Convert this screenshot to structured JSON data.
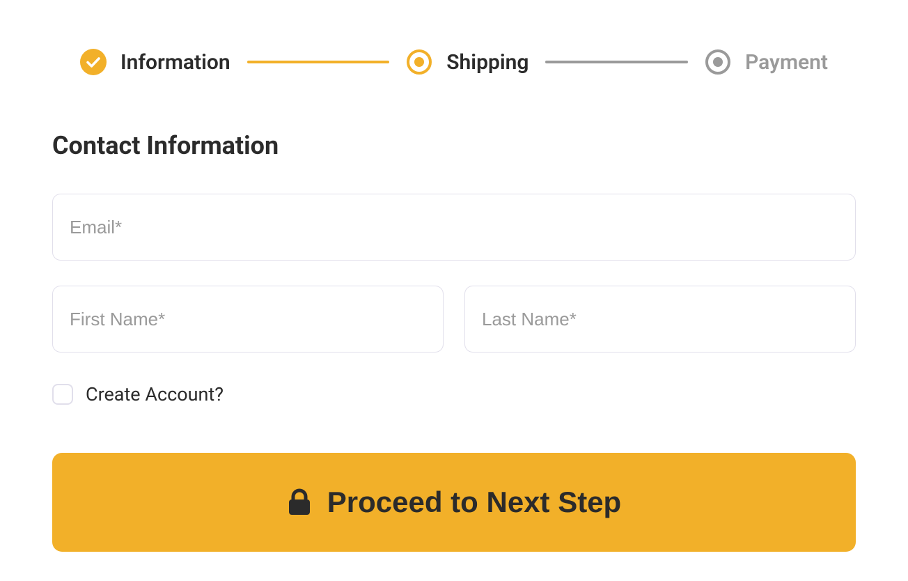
{
  "colors": {
    "accent": "#f2b029",
    "muted": "#9a9a9a",
    "text": "#2b2b2b",
    "border": "#e1dfeb"
  },
  "stepper": {
    "steps": [
      {
        "label": "Information",
        "state": "done"
      },
      {
        "label": "Shipping",
        "state": "current"
      },
      {
        "label": "Payment",
        "state": "upcoming"
      }
    ]
  },
  "heading": "Contact Information",
  "fields": {
    "email": {
      "placeholder": "Email*",
      "value": ""
    },
    "first_name": {
      "placeholder": "First Name*",
      "value": ""
    },
    "last_name": {
      "placeholder": "Last Name*",
      "value": ""
    }
  },
  "create_account": {
    "label": "Create Account?",
    "checked": false
  },
  "cta": {
    "label": "Proceed to Next Step",
    "icon": "lock-icon"
  }
}
